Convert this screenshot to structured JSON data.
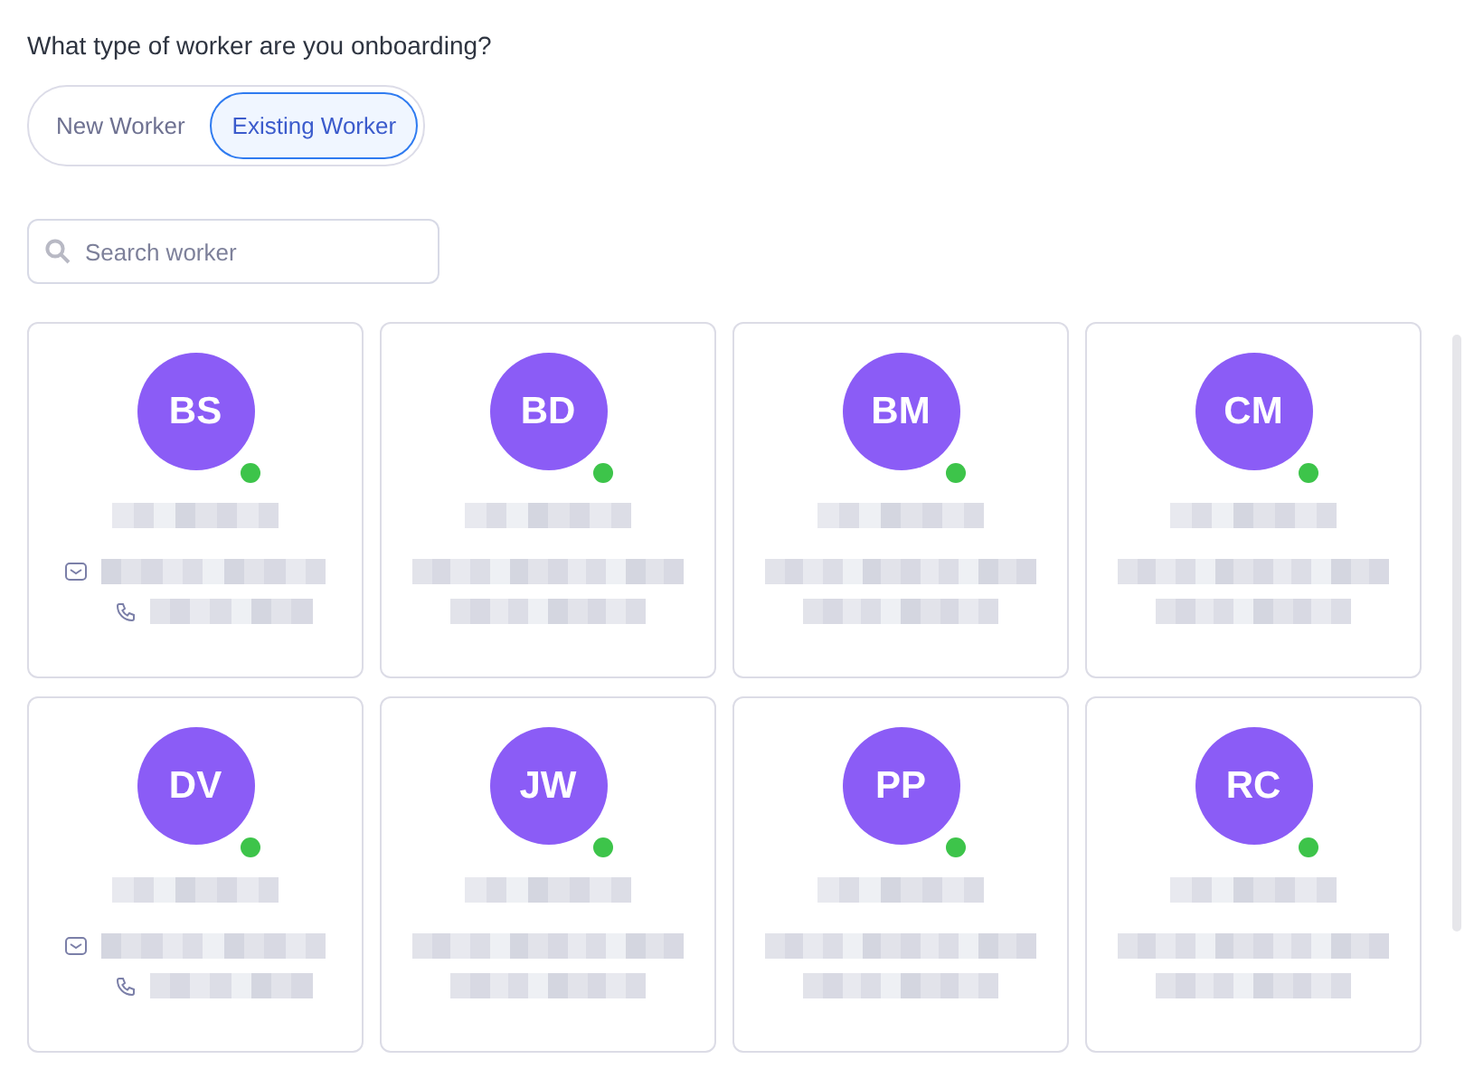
{
  "question": "What type of worker are you onboarding?",
  "worker_type_tabs": [
    {
      "label": "New Worker",
      "selected": false
    },
    {
      "label": "Existing Worker",
      "selected": true
    }
  ],
  "search": {
    "placeholder": "Search worker"
  },
  "workers": [
    {
      "initials": "BS",
      "online": true,
      "contact_icons": true
    },
    {
      "initials": "BD",
      "online": true,
      "contact_icons": false
    },
    {
      "initials": "BM",
      "online": true,
      "contact_icons": false
    },
    {
      "initials": "CM",
      "online": true,
      "contact_icons": false
    },
    {
      "initials": "DV",
      "online": true,
      "contact_icons": true
    },
    {
      "initials": "JW",
      "online": true,
      "contact_icons": false
    },
    {
      "initials": "PP",
      "online": true,
      "contact_icons": false
    },
    {
      "initials": "RC",
      "online": true,
      "contact_icons": false
    }
  ]
}
